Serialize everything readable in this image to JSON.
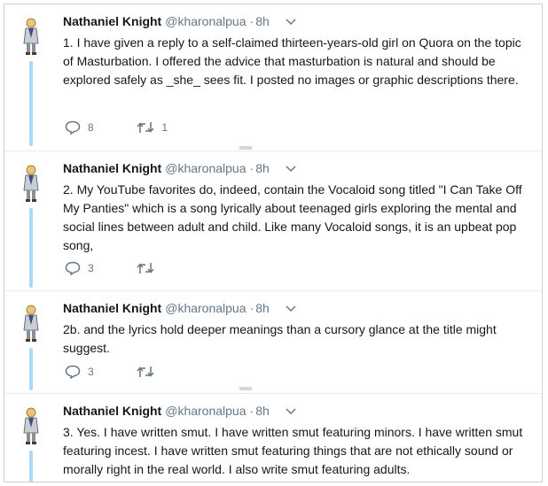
{
  "tweets": [
    {
      "name": "Nathaniel Knight",
      "handle": "@kharonalpua",
      "dot": "·",
      "time": "8h",
      "text": "1. I have given a reply to a self-claimed thirteen-years-old girl on Quora on the topic of Masturbation. I offered the advice that masturbation is natural and should be explored safely as _she_ sees fit. I posted no images or graphic descriptions there.",
      "replies": "8",
      "retweets": "1"
    },
    {
      "name": "Nathaniel Knight",
      "handle": "@kharonalpua",
      "dot": "·",
      "time": "8h",
      "text": "2. My YouTube favorites do, indeed, contain the Vocaloid song titled \"I Can Take Off My Panties\" which is a song lyrically about teenaged girls exploring the mental and social lines between adult and child. Like many Vocaloid songs, it is an upbeat pop song,",
      "replies": "3",
      "retweets": ""
    },
    {
      "name": "Nathaniel Knight",
      "handle": "@kharonalpua",
      "dot": "·",
      "time": "8h",
      "text": "2b. and the lyrics hold deeper meanings than a cursory glance at the title might suggest.",
      "replies": "3",
      "retweets": ""
    },
    {
      "name": "Nathaniel Knight",
      "handle": "@kharonalpua",
      "dot": "·",
      "time": "8h",
      "text": "3. Yes. I have written smut. I have written smut featuring minors. I have written smut featuring incest. I have written smut featuring things that are not ethically sound or morally right in the real world. I also write smut featuring adults."
    }
  ],
  "colors": {
    "thread_line": "#add8f7",
    "muted": "#657786",
    "divider": "#e6ecf0"
  },
  "icons": [
    "avatar-figure",
    "chevron-down-icon",
    "reply-icon",
    "retweet-icon"
  ]
}
